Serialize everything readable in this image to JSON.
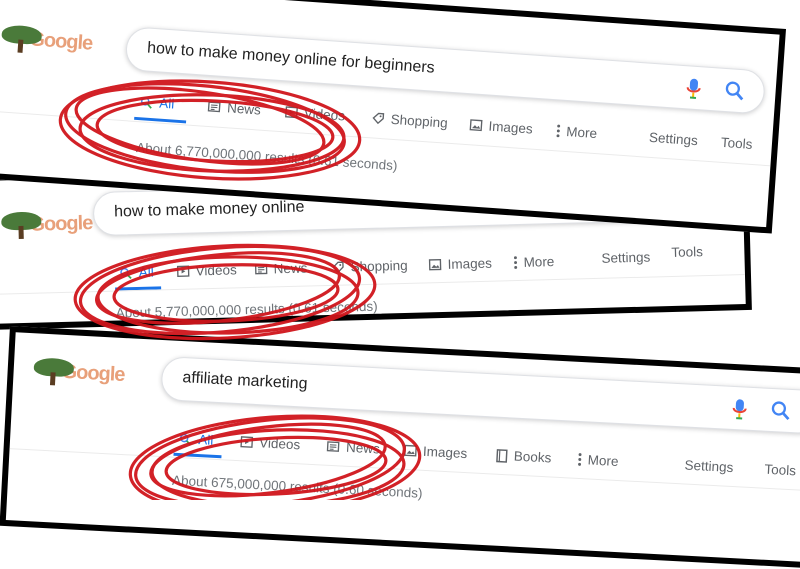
{
  "panels": [
    {
      "logo_text": "Google",
      "query": "how to make money online for beginners",
      "tabs": [
        "All",
        "News",
        "Videos",
        "Shopping",
        "Images",
        "More"
      ],
      "settings": "Settings",
      "tools": "Tools",
      "stats": "About 6,770,000,000 results (0.61 seconds)"
    },
    {
      "logo_text": "Google",
      "query": "how to make money online",
      "tabs": [
        "All",
        "Videos",
        "News",
        "Shopping",
        "Images",
        "More"
      ],
      "settings": "Settings",
      "tools": "Tools",
      "stats": "About 5,770,000,000 results (0.61 seconds)"
    },
    {
      "logo_text": "Google",
      "query": "affiliate marketing",
      "tabs": [
        "All",
        "Videos",
        "News",
        "Images",
        "Books",
        "More"
      ],
      "settings": "Settings",
      "tools": "Tools",
      "stats": "About 675,000,000 results (0.60 seconds)"
    }
  ],
  "colors": {
    "accent": "#1a73e8",
    "scribble": "#d0161c",
    "border": "#000000"
  }
}
